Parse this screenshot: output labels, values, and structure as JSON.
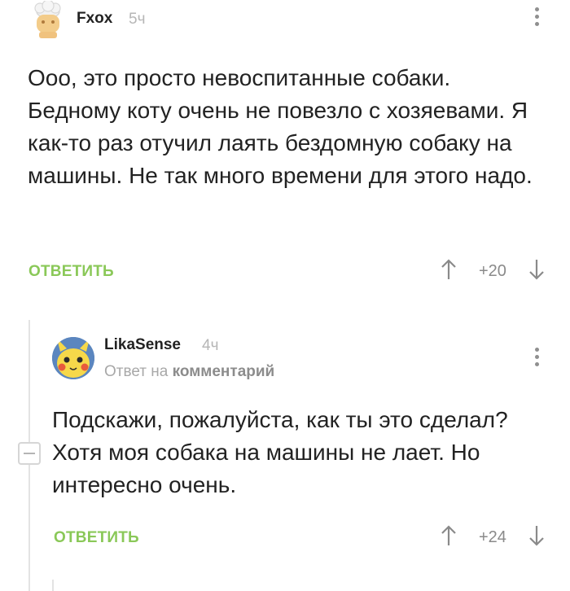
{
  "comments": [
    {
      "username": "Fxox",
      "time": "5ч",
      "text": "Ооо, это просто невоспитанные собаки. Бедному коту очень не повезло с хозяевами. Я как-то раз отучил лаять бездомную собаку на машины. Не так много времени для этого надо.",
      "reply_label": "ОТВЕТИТЬ",
      "rating": "+20"
    },
    {
      "username": "LikaSense",
      "time": "4ч",
      "reply_to_prefix": "Ответ на",
      "reply_to_target": "комментарий",
      "text": "Подскажи, пожалуйста, как ты это сделал? Хотя моя собака на машины не лает. Но интересно очень.",
      "reply_label": "ОТВЕТИТЬ",
      "rating": "+24"
    }
  ],
  "colors": {
    "reply": "#8ac858",
    "muted": "#b6b6b6",
    "text": "#222222"
  },
  "icons": [
    "chef-avatar",
    "pikachu-avatar",
    "more-vertical-icon",
    "arrow-up-icon",
    "arrow-down-icon",
    "collapse-minus-icon"
  ]
}
